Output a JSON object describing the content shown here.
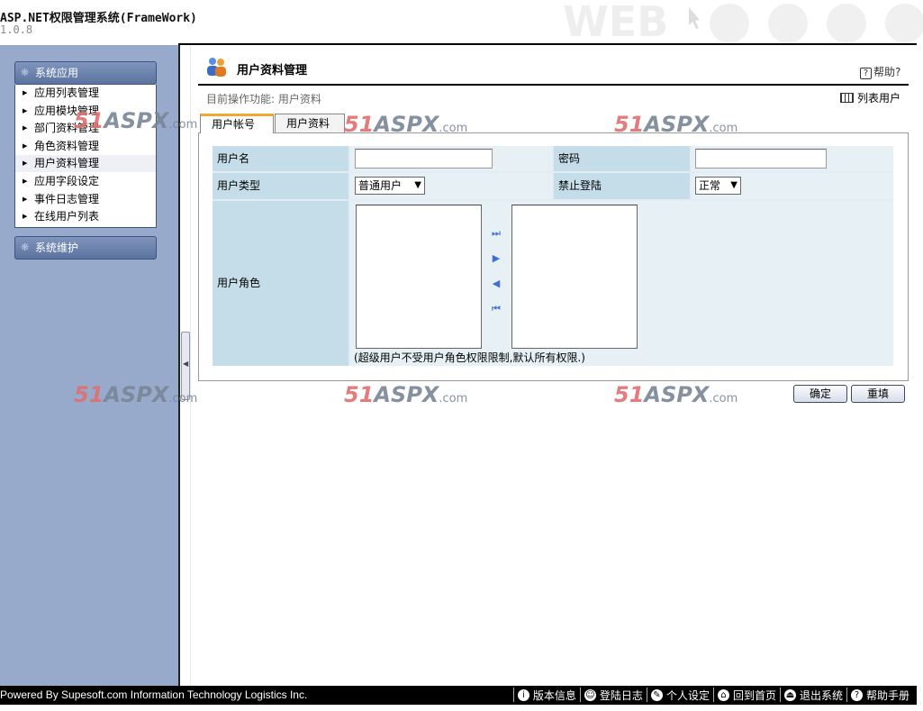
{
  "app": {
    "title": "ASP.NET权限管理系统(FrameWork)",
    "version": "1.0.8"
  },
  "sidebar": {
    "panels": [
      {
        "label": "系统应用"
      },
      {
        "label": "系统维护"
      }
    ],
    "items": [
      {
        "label": "应用列表管理"
      },
      {
        "label": "应用模块管理"
      },
      {
        "label": "部门资料管理"
      },
      {
        "label": "角色资料管理"
      },
      {
        "label": "用户资料管理"
      },
      {
        "label": "应用字段设定"
      },
      {
        "label": "事件日志管理"
      },
      {
        "label": "在线用户列表"
      }
    ]
  },
  "page": {
    "title": "用户资料管理",
    "help": "帮助?",
    "current_op": "目前操作功能: 用户资料",
    "list_users": "列表用户",
    "tabs": [
      {
        "label": "用户帐号"
      },
      {
        "label": "用户资料"
      }
    ]
  },
  "form": {
    "username_label": "用户名",
    "username_value": "",
    "password_label": "密码",
    "password_value": "",
    "usertype_label": "用户类型",
    "usertype_value": "普通用户",
    "login_ban_label": "禁止登陆",
    "login_ban_value": "正常",
    "roles_label": "用户角色",
    "roles_note": "(超级用户不受用户角色权限限制,默认所有权限.)"
  },
  "buttons": {
    "confirm": "确定",
    "reset": "重填"
  },
  "watermark": {
    "number": "51",
    "brand": "ASPX",
    "suffix": ".com"
  },
  "footer": {
    "powered": "Powered By Supesoft.com Information Technology Logistics Inc.",
    "links": [
      {
        "label": "版本信息",
        "icon": "info-icon"
      },
      {
        "label": "登陆日志",
        "icon": "users-icon"
      },
      {
        "label": "个人设定",
        "icon": "settings-icon"
      },
      {
        "label": "回到首页",
        "icon": "home-icon"
      },
      {
        "label": "退出系统",
        "icon": "logout-icon"
      },
      {
        "label": "帮助手册",
        "icon": "help-icon"
      }
    ]
  },
  "colors": {
    "sidebar_bg": "#98aacb",
    "label_cell": "#c5dde8",
    "tab_accent": "#f0a830"
  }
}
